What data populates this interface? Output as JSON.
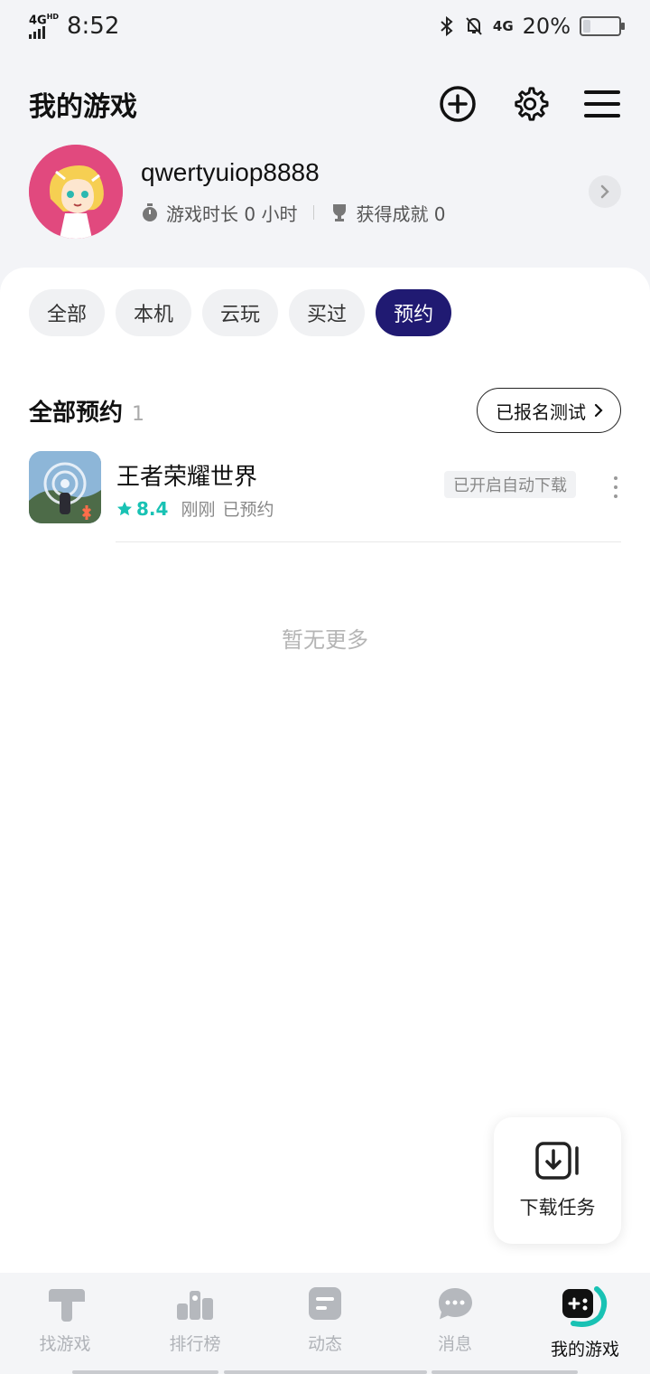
{
  "status_bar": {
    "network_label": "4G",
    "network_hd": "HD",
    "time": "8:52",
    "secondary_network": "4G",
    "battery_percent": "20%",
    "battery_level": 0.2
  },
  "header": {
    "title": "我的游戏",
    "icons": [
      "add-circle-icon",
      "gear-icon",
      "menu-icon"
    ]
  },
  "profile": {
    "username": "qwertyuiop8888",
    "playtime_label": "游戏时长 0 小时",
    "achievement_label": "获得成就 0"
  },
  "tabs": [
    {
      "label": "全部",
      "active": false
    },
    {
      "label": "本机",
      "active": false
    },
    {
      "label": "云玩",
      "active": false
    },
    {
      "label": "买过",
      "active": false
    },
    {
      "label": "预约",
      "active": true
    }
  ],
  "section": {
    "title": "全部预约",
    "count": "1",
    "signed_test_button": "已报名测试"
  },
  "games": [
    {
      "name": "王者荣耀世界",
      "rating": "8.4",
      "time": "刚刚",
      "status": "已预约",
      "badge": "已开启自动下载"
    }
  ],
  "empty_hint": "暂无更多",
  "fab": {
    "label": "下载任务",
    "icon": "download-task-icon"
  },
  "bottom_nav": [
    {
      "label": "找游戏",
      "icon": "find-games-icon",
      "active": false
    },
    {
      "label": "排行榜",
      "icon": "leaderboard-icon",
      "active": false
    },
    {
      "label": "动态",
      "icon": "feed-icon",
      "active": false
    },
    {
      "label": "消息",
      "icon": "message-icon",
      "active": false
    },
    {
      "label": "我的游戏",
      "icon": "my-games-icon",
      "active": true
    }
  ],
  "colors": {
    "accent": "#201a72",
    "rating": "#19c2b4",
    "avatar_bg": "#e1497e"
  }
}
